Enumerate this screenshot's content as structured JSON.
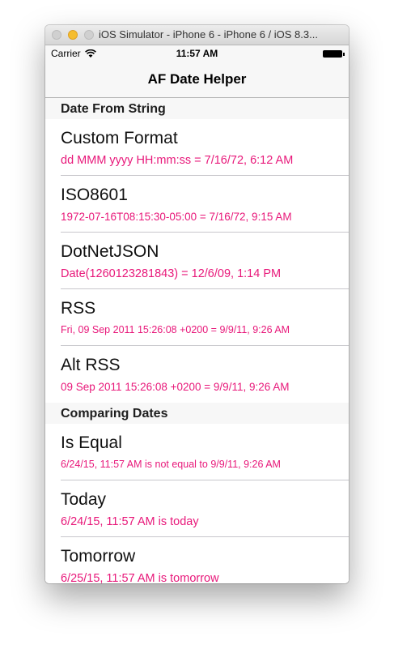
{
  "window": {
    "title": "iOS Simulator - iPhone 6 - iPhone 6 / iOS 8.3..."
  },
  "status_bar": {
    "carrier": "Carrier",
    "time": "11:57 AM"
  },
  "nav": {
    "title": "AF Date Helper"
  },
  "sections": [
    {
      "header": "Date From String",
      "rows": [
        {
          "title": "Custom Format",
          "subtitle": "dd MMM yyyy HH:mm:ss = 7/16/72, 6:12 AM"
        },
        {
          "title": "ISO8601",
          "subtitle": "1972-07-16T08:15:30-05:00 = 7/16/72, 9:15 AM"
        },
        {
          "title": "DotNetJSON",
          "subtitle": "Date(1260123281843) = 12/6/09, 1:14 PM"
        },
        {
          "title": "RSS",
          "subtitle": "Fri, 09 Sep 2011 15:26:08 +0200 = 9/9/11, 9:26 AM"
        },
        {
          "title": "Alt RSS",
          "subtitle": "09 Sep 2011 15:26:08 +0200 = 9/9/11, 9:26 AM"
        }
      ]
    },
    {
      "header": "Comparing Dates",
      "rows": [
        {
          "title": "Is Equal",
          "subtitle": "6/24/15, 11:57 AM is not equal to 9/9/11, 9:26 AM"
        },
        {
          "title": "Today",
          "subtitle": "6/24/15, 11:57 AM is today"
        },
        {
          "title": "Tomorrow",
          "subtitle": "6/25/15, 11:57 AM is tomorrow"
        }
      ]
    }
  ],
  "colors": {
    "accent": "#e8187a",
    "bar_background": "#f7f7f7",
    "separator": "#c8c7cc"
  }
}
